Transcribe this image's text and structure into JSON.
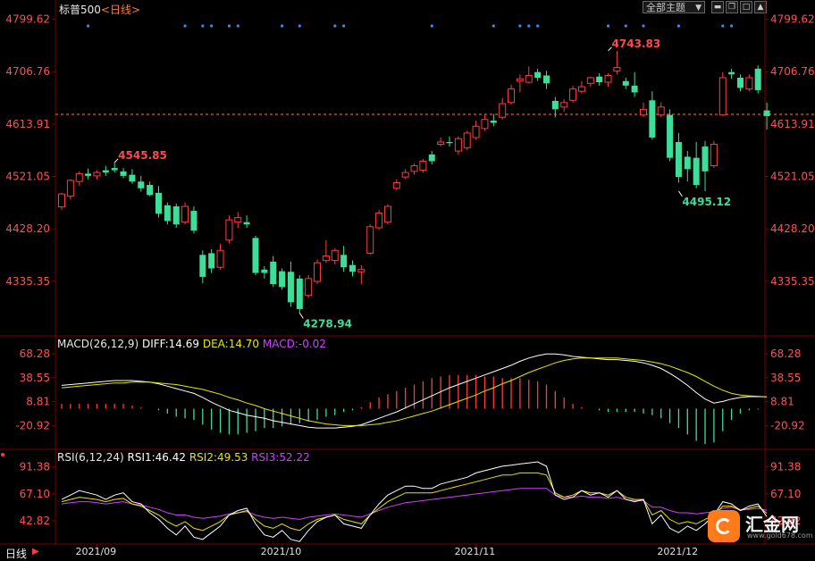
{
  "header": {
    "symbol": "标普500",
    "period_tag": "<日线>",
    "theme_button": "全部主题"
  },
  "bottom": {
    "period_label": "日线"
  },
  "watermark": {
    "name": "汇金网",
    "site": "www.gold678.com",
    "logo_icon": "gold678-logo-icon"
  },
  "colors": {
    "up": "#ff3c3c",
    "down": "#3fdd9a",
    "price_label": "#ff4a4a",
    "dif": "#ffffff",
    "dea": "#e6e600",
    "macd_label": "#d040ff",
    "rsi1": "#ffffff",
    "rsi2": "#e6e600",
    "rsi3": "#d040ff",
    "grid": "#7a0000"
  },
  "chart_data": [
    {
      "type": "candlestick",
      "panel": "price",
      "yticks": [
        "4799.62",
        "4706.76",
        "4613.91",
        "4521.05",
        "4428.20",
        "4335.35"
      ],
      "ylim": [
        4240,
        4810
      ],
      "xticks": [
        "2021/09",
        "2021/10",
        "2021/11",
        "2021/12"
      ],
      "xtick_index": [
        4,
        25,
        47,
        70
      ],
      "current_price": 4631,
      "annotations": [
        {
          "text": "4545.85",
          "index": 6,
          "value": 4545.85,
          "kind": "high"
        },
        {
          "text": "4278.94",
          "index": 27,
          "value": 4278.94,
          "kind": "low"
        },
        {
          "text": "4743.83",
          "index": 62,
          "value": 4743.83,
          "kind": "high"
        },
        {
          "text": "4495.12",
          "index": 70,
          "value": 4495.12,
          "kind": "low"
        }
      ],
      "event_marker_index": [
        3,
        14,
        16,
        17,
        19,
        20,
        25,
        27,
        31,
        32,
        42,
        49,
        52,
        53,
        54,
        62,
        64,
        66,
        70,
        75,
        76
      ],
      "candles": [
        {
          "o": 4467,
          "h": 4492,
          "l": 4462,
          "c": 4490
        },
        {
          "o": 4486,
          "h": 4516,
          "l": 4480,
          "c": 4514
        },
        {
          "o": 4512,
          "h": 4530,
          "l": 4505,
          "c": 4526
        },
        {
          "o": 4526,
          "h": 4535,
          "l": 4516,
          "c": 4522
        },
        {
          "o": 4522,
          "h": 4532,
          "l": 4516,
          "c": 4528
        },
        {
          "o": 4532,
          "h": 4540,
          "l": 4522,
          "c": 4528
        },
        {
          "o": 4536,
          "h": 4546,
          "l": 4528,
          "c": 4532
        },
        {
          "o": 4530,
          "h": 4536,
          "l": 4518,
          "c": 4522
        },
        {
          "o": 4524,
          "h": 4534,
          "l": 4508,
          "c": 4512
        },
        {
          "o": 4512,
          "h": 4522,
          "l": 4494,
          "c": 4500
        },
        {
          "o": 4506,
          "h": 4512,
          "l": 4486,
          "c": 4488
        },
        {
          "o": 4492,
          "h": 4504,
          "l": 4448,
          "c": 4455
        },
        {
          "o": 4470,
          "h": 4475,
          "l": 4436,
          "c": 4442
        },
        {
          "o": 4468,
          "h": 4473,
          "l": 4430,
          "c": 4436
        },
        {
          "o": 4440,
          "h": 4475,
          "l": 4436,
          "c": 4468
        },
        {
          "o": 4460,
          "h": 4468,
          "l": 4420,
          "c": 4425
        },
        {
          "o": 4382,
          "h": 4390,
          "l": 4332,
          "c": 4343
        },
        {
          "o": 4385,
          "h": 4392,
          "l": 4350,
          "c": 4358
        },
        {
          "o": 4360,
          "h": 4402,
          "l": 4356,
          "c": 4390
        },
        {
          "o": 4408,
          "h": 4452,
          "l": 4402,
          "c": 4444
        },
        {
          "o": 4440,
          "h": 4458,
          "l": 4430,
          "c": 4448
        },
        {
          "o": 4440,
          "h": 4452,
          "l": 4430,
          "c": 4436
        },
        {
          "o": 4412,
          "h": 4416,
          "l": 4346,
          "c": 4350
        },
        {
          "o": 4356,
          "h": 4362,
          "l": 4340,
          "c": 4350
        },
        {
          "o": 4370,
          "h": 4380,
          "l": 4325,
          "c": 4330
        },
        {
          "o": 4353,
          "h": 4358,
          "l": 4320,
          "c": 4325
        },
        {
          "o": 4352,
          "h": 4370,
          "l": 4290,
          "c": 4298
        },
        {
          "o": 4340,
          "h": 4346,
          "l": 4278,
          "c": 4286
        },
        {
          "o": 4310,
          "h": 4346,
          "l": 4306,
          "c": 4340
        },
        {
          "o": 4335,
          "h": 4374,
          "l": 4330,
          "c": 4368
        },
        {
          "o": 4372,
          "h": 4408,
          "l": 4368,
          "c": 4380
        },
        {
          "o": 4372,
          "h": 4394,
          "l": 4365,
          "c": 4390
        },
        {
          "o": 4382,
          "h": 4398,
          "l": 4352,
          "c": 4360
        },
        {
          "o": 4364,
          "h": 4372,
          "l": 4344,
          "c": 4352
        },
        {
          "o": 4352,
          "h": 4364,
          "l": 4330,
          "c": 4356
        },
        {
          "o": 4385,
          "h": 4436,
          "l": 4382,
          "c": 4432
        },
        {
          "o": 4430,
          "h": 4462,
          "l": 4426,
          "c": 4456
        },
        {
          "o": 4440,
          "h": 4472,
          "l": 4436,
          "c": 4468
        },
        {
          "o": 4500,
          "h": 4516,
          "l": 4496,
          "c": 4510
        },
        {
          "o": 4520,
          "h": 4534,
          "l": 4516,
          "c": 4528
        },
        {
          "o": 4530,
          "h": 4544,
          "l": 4524,
          "c": 4540
        },
        {
          "o": 4532,
          "h": 4552,
          "l": 4528,
          "c": 4548
        },
        {
          "o": 4560,
          "h": 4566,
          "l": 4542,
          "c": 4548
        },
        {
          "o": 4578,
          "h": 4590,
          "l": 4574,
          "c": 4582
        },
        {
          "o": 4582,
          "h": 4592,
          "l": 4574,
          "c": 4580
        },
        {
          "o": 4566,
          "h": 4592,
          "l": 4560,
          "c": 4588
        },
        {
          "o": 4572,
          "h": 4602,
          "l": 4568,
          "c": 4598
        },
        {
          "o": 4590,
          "h": 4620,
          "l": 4586,
          "c": 4610
        },
        {
          "o": 4606,
          "h": 4630,
          "l": 4602,
          "c": 4622
        },
        {
          "o": 4620,
          "h": 4632,
          "l": 4610,
          "c": 4616
        },
        {
          "o": 4626,
          "h": 4660,
          "l": 4622,
          "c": 4650
        },
        {
          "o": 4652,
          "h": 4684,
          "l": 4648,
          "c": 4676
        },
        {
          "o": 4690,
          "h": 4702,
          "l": 4670,
          "c": 4694
        },
        {
          "o": 4688,
          "h": 4716,
          "l": 4686,
          "c": 4700
        },
        {
          "o": 4706,
          "h": 4712,
          "l": 4690,
          "c": 4696
        },
        {
          "o": 4700,
          "h": 4708,
          "l": 4676,
          "c": 4686
        },
        {
          "o": 4655,
          "h": 4662,
          "l": 4626,
          "c": 4640
        },
        {
          "o": 4644,
          "h": 4658,
          "l": 4636,
          "c": 4652
        },
        {
          "o": 4656,
          "h": 4682,
          "l": 4652,
          "c": 4676
        },
        {
          "o": 4672,
          "h": 4690,
          "l": 4668,
          "c": 4680
        },
        {
          "o": 4686,
          "h": 4698,
          "l": 4680,
          "c": 4696
        },
        {
          "o": 4698,
          "h": 4704,
          "l": 4682,
          "c": 4688
        },
        {
          "o": 4688,
          "h": 4704,
          "l": 4680,
          "c": 4700
        },
        {
          "o": 4708,
          "h": 4744,
          "l": 4702,
          "c": 4714
        },
        {
          "o": 4690,
          "h": 4696,
          "l": 4676,
          "c": 4682
        },
        {
          "o": 4682,
          "h": 4706,
          "l": 4662,
          "c": 4670
        },
        {
          "o": 4630,
          "h": 4652,
          "l": 4626,
          "c": 4640
        },
        {
          "o": 4656,
          "h": 4672,
          "l": 4586,
          "c": 4590
        },
        {
          "o": 4630,
          "h": 4652,
          "l": 4626,
          "c": 4644
        },
        {
          "o": 4630,
          "h": 4640,
          "l": 4548,
          "c": 4554
        },
        {
          "o": 4582,
          "h": 4598,
          "l": 4510,
          "c": 4520
        },
        {
          "o": 4556,
          "h": 4566,
          "l": 4512,
          "c": 4534
        },
        {
          "o": 4554,
          "h": 4582,
          "l": 4500,
          "c": 4506
        },
        {
          "o": 4574,
          "h": 4584,
          "l": 4495,
          "c": 4530
        },
        {
          "o": 4540,
          "h": 4584,
          "l": 4536,
          "c": 4578
        },
        {
          "o": 4630,
          "h": 4706,
          "l": 4628,
          "c": 4696
        },
        {
          "o": 4706,
          "h": 4712,
          "l": 4694,
          "c": 4702
        },
        {
          "o": 4696,
          "h": 4702,
          "l": 4672,
          "c": 4678
        },
        {
          "o": 4676,
          "h": 4702,
          "l": 4672,
          "c": 4696
        },
        {
          "o": 4712,
          "h": 4718,
          "l": 4668,
          "c": 4674
        },
        {
          "o": 4638,
          "h": 4652,
          "l": 4604,
          "c": 4628
        }
      ]
    },
    {
      "type": "macd",
      "panel": "macd",
      "label": "MACD(26,12,9)",
      "legend": [
        {
          "text": "DIFF:14.69",
          "color": "#ffffff"
        },
        {
          "text": "DEA:14.70",
          "color": "#e6e600"
        },
        {
          "text": "MACD:-0.02",
          "color": "#d040ff"
        }
      ],
      "yticks": [
        "68.28",
        "38.55",
        "8.81",
        "-20.92"
      ],
      "ylim": [
        -45,
        75
      ],
      "dif": [
        29,
        30,
        31,
        32,
        33,
        34,
        35,
        35,
        35,
        34,
        33,
        31,
        28,
        25,
        22,
        19,
        14,
        8,
        3,
        -2,
        -5,
        -8,
        -10,
        -12,
        -15,
        -17,
        -19,
        -21,
        -23,
        -24,
        -24,
        -24,
        -23,
        -22,
        -20,
        -16,
        -12,
        -8,
        -4,
        1,
        6,
        11,
        16,
        21,
        26,
        30,
        34,
        38,
        42,
        46,
        50,
        54,
        59,
        63,
        66,
        68,
        68,
        67,
        65,
        64,
        63,
        62,
        61,
        61,
        60,
        59,
        57,
        54,
        50,
        44,
        37,
        29,
        20,
        12,
        7,
        9,
        12,
        14,
        15,
        15,
        14.69
      ],
      "dea": [
        26,
        27,
        28,
        29,
        30,
        31,
        32,
        32,
        33,
        33,
        33,
        32,
        31,
        30,
        28,
        26,
        24,
        21,
        18,
        14,
        11,
        7,
        4,
        0,
        -3,
        -6,
        -9,
        -12,
        -15,
        -17,
        -19,
        -20,
        -21,
        -21,
        -21,
        -20,
        -19,
        -17,
        -15,
        -12,
        -9,
        -6,
        -3,
        1,
        5,
        9,
        13,
        17,
        22,
        26,
        31,
        35,
        40,
        45,
        49,
        53,
        57,
        60,
        62,
        63,
        63,
        63,
        63,
        63,
        62,
        61,
        60,
        58,
        56,
        53,
        49,
        45,
        40,
        34,
        28,
        23,
        19,
        17,
        16,
        15.5,
        14.7
      ],
      "hist": [
        6,
        6,
        6,
        6,
        6,
        6,
        6,
        6,
        4,
        2,
        0,
        -2,
        -6,
        -10,
        -12,
        -14,
        -20,
        -26,
        -30,
        -32,
        -32,
        -30,
        -28,
        -24,
        -24,
        -22,
        -20,
        -18,
        -16,
        -14,
        -10,
        -8,
        -4,
        -2,
        2,
        8,
        14,
        18,
        22,
        26,
        30,
        34,
        38,
        40,
        42,
        42,
        42,
        42,
        40,
        40,
        38,
        38,
        38,
        36,
        34,
        30,
        22,
        14,
        6,
        2,
        0,
        -2,
        -4,
        -4,
        -4,
        -4,
        -6,
        -8,
        -12,
        -18,
        -24,
        -32,
        -40,
        -44,
        -42,
        -28,
        -14,
        -6,
        -2,
        -1,
        -0.02
      ]
    },
    {
      "type": "rsi",
      "panel": "rsi",
      "label": "RSI(6,12,24)",
      "legend": [
        {
          "text": "RSI1:46.42",
          "color": "#ffffff"
        },
        {
          "text": "RSI2:49.53",
          "color": "#e6e600"
        },
        {
          "text": "RSI3:52.22",
          "color": "#d040ff"
        }
      ],
      "yticks": [
        "91.38",
        "67.10",
        "42.82"
      ],
      "ylim": [
        25,
        100
      ],
      "rsi1": [
        62,
        66,
        70,
        68,
        66,
        62,
        66,
        68,
        60,
        58,
        50,
        44,
        36,
        30,
        38,
        28,
        26,
        32,
        38,
        48,
        52,
        54,
        40,
        30,
        28,
        34,
        26,
        24,
        34,
        42,
        46,
        48,
        40,
        38,
        36,
        48,
        58,
        66,
        70,
        74,
        74,
        72,
        72,
        76,
        78,
        80,
        82,
        86,
        88,
        90,
        92,
        93,
        94,
        95,
        96,
        92,
        66,
        62,
        64,
        70,
        66,
        68,
        64,
        70,
        62,
        60,
        62,
        40,
        48,
        36,
        32,
        38,
        34,
        40,
        48,
        60,
        58,
        52,
        56,
        58,
        46.42
      ],
      "rsi2": [
        60,
        62,
        64,
        63,
        62,
        60,
        62,
        63,
        58,
        56,
        52,
        48,
        42,
        38,
        42,
        36,
        34,
        38,
        42,
        48,
        50,
        52,
        44,
        38,
        36,
        40,
        36,
        34,
        40,
        44,
        46,
        48,
        44,
        42,
        40,
        48,
        54,
        60,
        64,
        68,
        68,
        68,
        68,
        70,
        72,
        74,
        76,
        78,
        80,
        82,
        84,
        84,
        86,
        86,
        86,
        84,
        68,
        64,
        66,
        70,
        68,
        68,
        66,
        70,
        64,
        62,
        62,
        48,
        52,
        44,
        40,
        42,
        40,
        44,
        48,
        56,
        56,
        52,
        54,
        56,
        49.53
      ],
      "rsi3": [
        58,
        59,
        60,
        60,
        59,
        58,
        59,
        60,
        58,
        57,
        55,
        53,
        50,
        48,
        48,
        46,
        45,
        46,
        47,
        49,
        50,
        51,
        48,
        46,
        45,
        46,
        45,
        44,
        46,
        47,
        48,
        49,
        48,
        47,
        46,
        49,
        52,
        55,
        57,
        59,
        60,
        61,
        62,
        63,
        64,
        65,
        66,
        67,
        68,
        69,
        70,
        71,
        72,
        72,
        72,
        72,
        66,
        64,
        64,
        65,
        64,
        64,
        63,
        64,
        62,
        61,
        61,
        55,
        55,
        52,
        50,
        50,
        49,
        50,
        51,
        54,
        55,
        53,
        53,
        54,
        52.22
      ]
    }
  ]
}
